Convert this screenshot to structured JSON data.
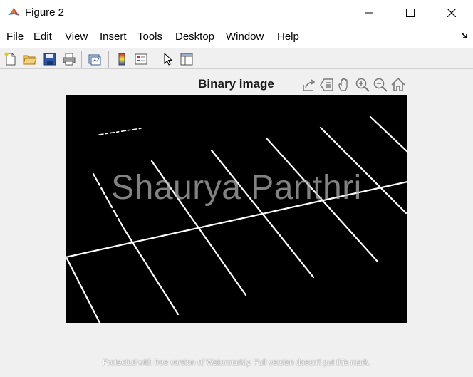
{
  "window": {
    "title": "Figure 2",
    "minimize_icon": "minimize-icon",
    "maximize_icon": "maximize-icon",
    "close_icon": "close-icon"
  },
  "menu": {
    "items": [
      "File",
      "Edit",
      "View",
      "Insert",
      "Tools",
      "Desktop",
      "Window",
      "Help"
    ]
  },
  "toolbar": {
    "icons": [
      "new-figure-icon",
      "open-file-icon",
      "save-icon",
      "print-icon",
      "link-plot-icon",
      "insert-colorbar-icon",
      "insert-legend-icon",
      "edit-plot-icon",
      "property-inspector-icon"
    ]
  },
  "axes_toolbar": {
    "icons": [
      "export-icon",
      "brush-icon",
      "pan-icon",
      "zoom-in-icon",
      "zoom-out-icon",
      "home-icon"
    ]
  },
  "figure": {
    "title": "Binary image",
    "background": "#000000",
    "line_color": "#ffffff"
  },
  "watermark": {
    "text": "Shaurya Panthri"
  },
  "footer": {
    "text": "Protected with free version of Watermarkly. Full version doesn't put this mark."
  }
}
